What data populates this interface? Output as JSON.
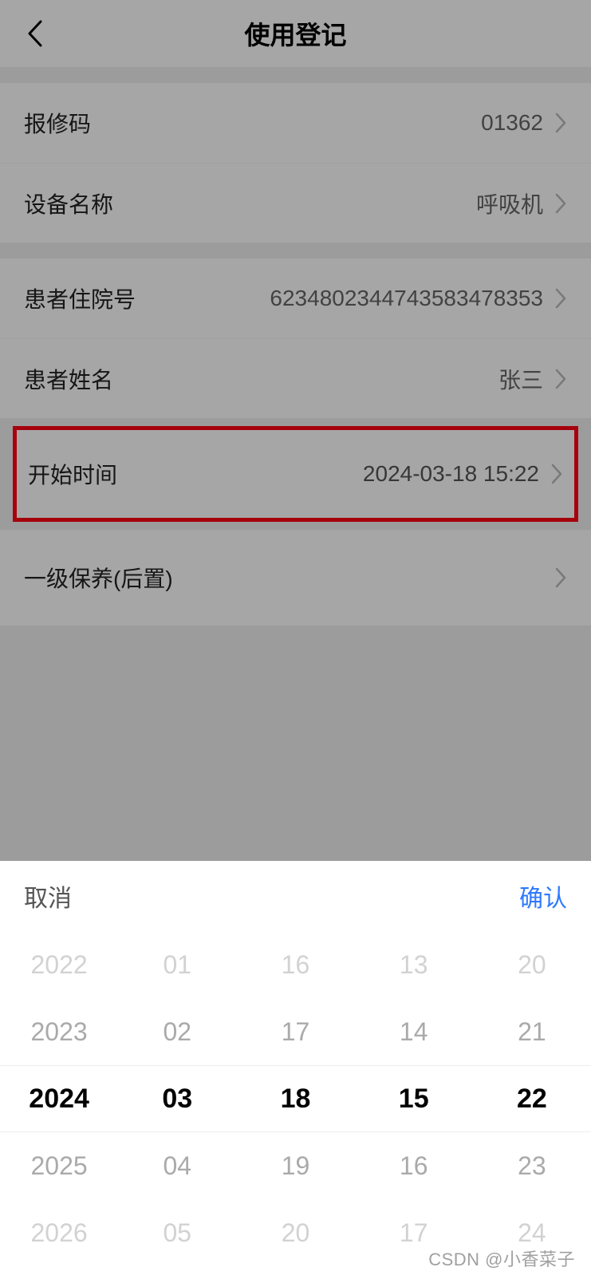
{
  "header": {
    "title": "使用登记"
  },
  "rows": {
    "repair_code": {
      "label": "报修码",
      "value": "01362"
    },
    "device_name": {
      "label": "设备名称",
      "value": "呼吸机"
    },
    "patient_no": {
      "label": "患者住院号",
      "value": "6234802344743583478353"
    },
    "patient_name": {
      "label": "患者姓名",
      "value": "张三"
    },
    "start_time": {
      "label": "开始时间",
      "value": "2024-03-18 15:22"
    },
    "maintenance": {
      "label": "一级保养(后置)",
      "value": ""
    }
  },
  "picker": {
    "cancel": "取消",
    "confirm": "确认",
    "columns": [
      {
        "items": [
          "2022",
          "2023",
          "2024",
          "2025",
          "2026"
        ],
        "selected_index": 2
      },
      {
        "items": [
          "01",
          "02",
          "03",
          "04",
          "05"
        ],
        "selected_index": 2
      },
      {
        "items": [
          "16",
          "17",
          "18",
          "19",
          "20"
        ],
        "selected_index": 2
      },
      {
        "items": [
          "13",
          "14",
          "15",
          "16",
          "17"
        ],
        "selected_index": 2
      },
      {
        "items": [
          "20",
          "21",
          "22",
          "23",
          "24"
        ],
        "selected_index": 2
      }
    ]
  },
  "watermark": "CSDN @小香菜子"
}
